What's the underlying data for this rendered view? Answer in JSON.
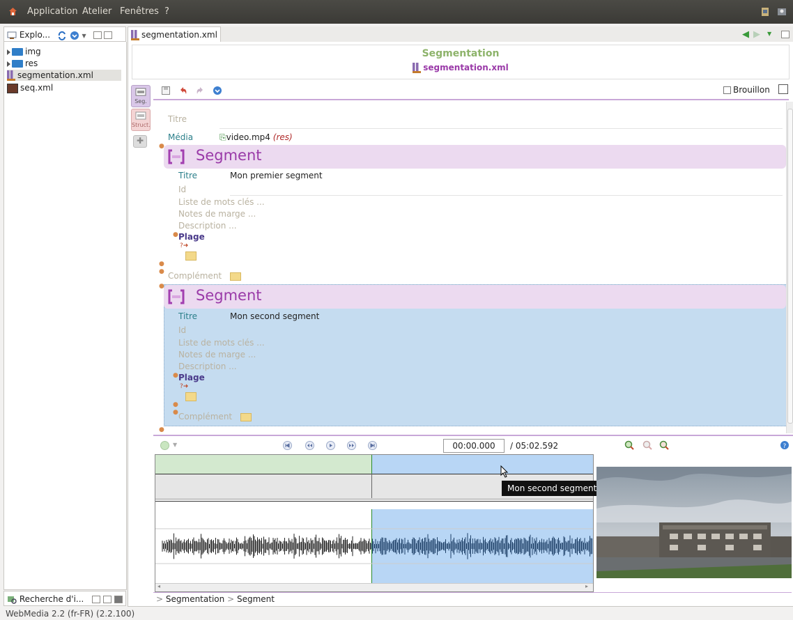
{
  "menubar": {
    "items": [
      "Application",
      "Atelier",
      "Fenêtres",
      "?"
    ]
  },
  "explorer": {
    "tab_label": "Explo...",
    "tree": [
      {
        "label": "img",
        "type": "folder"
      },
      {
        "label": "res",
        "type": "folder"
      },
      {
        "label": "segmentation.xml",
        "type": "xml",
        "selected": true
      },
      {
        "label": "seq.xml",
        "type": "seq"
      }
    ]
  },
  "search_panel": {
    "tab_label": "Recherche d'i..."
  },
  "statusbar": {
    "text": "WebMedia 2.2 (fr-FR) (2.2.100)"
  },
  "editor": {
    "tab_label": "segmentation.xml",
    "header_title": "Segmentation",
    "header_file": "segmentation.xml",
    "side_tabs": [
      "Seg.",
      "Struct."
    ],
    "draft_label": "Brouillon",
    "doc": {
      "titre_label": "Titre",
      "media_label": "Média",
      "media_value": "video.mp4",
      "media_origin": "(res)",
      "segments": [
        {
          "heading": "Segment",
          "titre_label": "Titre",
          "titre_value": "Mon premier segment",
          "id_label": "Id",
          "keywords_label": "Liste de mots clés ...",
          "notes_label": "Notes de marge ...",
          "desc_label": "Description ...",
          "plage_label": "Plage",
          "complement_label": "Complément"
        },
        {
          "heading": "Segment",
          "titre_label": "Titre",
          "titre_value": "Mon second segment",
          "id_label": "Id",
          "keywords_label": "Liste de mots clés ...",
          "notes_label": "Notes de marge ...",
          "desc_label": "Description ...",
          "plage_label": "Plage",
          "complement_label": "Complément"
        }
      ]
    },
    "player": {
      "current_time": "00:00.000",
      "total_time": "/ 05:02.592",
      "tooltip": "Mon second segment"
    },
    "breadcrumb": [
      "Segmentation",
      "Segment"
    ],
    "colors": {
      "accent": "#9a3aa8",
      "teal": "#2b7f8a",
      "selection": "#c5dcf0",
      "segment_green": "#d3e9cf",
      "segment_blue": "#b8d6f5"
    }
  }
}
